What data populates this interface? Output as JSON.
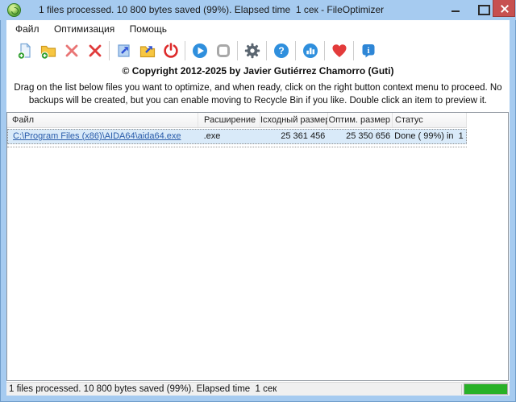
{
  "window": {
    "title": "1 files processed. 10 800 bytes saved (99%). Elapsed time  1 сек - FileOptimizer",
    "app_icon": "fileoptimizer-logo-icon",
    "controls": [
      "minimize-icon",
      "maximize-icon",
      "close-icon"
    ]
  },
  "menu": {
    "items": [
      {
        "label": "Файл"
      },
      {
        "label": "Оптимизация"
      },
      {
        "label": "Помощь"
      }
    ]
  },
  "toolbar": {
    "buttons": [
      {
        "icon": "add-files-icon"
      },
      {
        "icon": "add-folder-icon"
      },
      {
        "icon": "remove-entry-icon"
      },
      {
        "icon": "remove-all-icon"
      },
      {
        "icon": "open-file-icon"
      },
      {
        "icon": "open-folder-icon"
      },
      {
        "icon": "exit-power-icon"
      },
      {
        "icon": "optimize-play-icon"
      },
      {
        "icon": "stop-icon"
      },
      {
        "icon": "options-gear-icon"
      },
      {
        "icon": "help-icon"
      },
      {
        "icon": "statistics-icon"
      },
      {
        "icon": "donate-heart-icon"
      },
      {
        "icon": "about-info-icon"
      }
    ]
  },
  "body": {
    "copyright": "© Copyright 2012-2025 by Javier Gutiérrez Chamorro (Guti)",
    "instructions": "Drag on the list below files you want to optimize, and when ready, click on the right button context menu to proceed. No backups will be created, but you can enable moving to Recycle Bin if you like. Double click an item to preview it."
  },
  "table": {
    "columns": [
      "Файл",
      "Расширение",
      "Iсходный размер",
      "Оптим. размер",
      "Статус"
    ],
    "rows": [
      {
        "file": "C:\\Program Files (x86)\\AIDA64\\aida64.exe",
        "extension": ".exe",
        "original_size": "25 361 456",
        "optimized_size": "25 350 656",
        "status": "Done ( 99%) in  1"
      }
    ]
  },
  "status_bar": {
    "text": "1 files processed. 10 800 bytes saved (99%). Elapsed time  1 сек",
    "progress_percent": 100
  },
  "colors": {
    "titlebar_blue": "#a6cbf0",
    "close_red": "#c75050",
    "link_blue": "#2a5caa",
    "selected_row": "#d9eaf9",
    "progress_green": "#28b128",
    "accent_blue": "#2f8fdd"
  }
}
